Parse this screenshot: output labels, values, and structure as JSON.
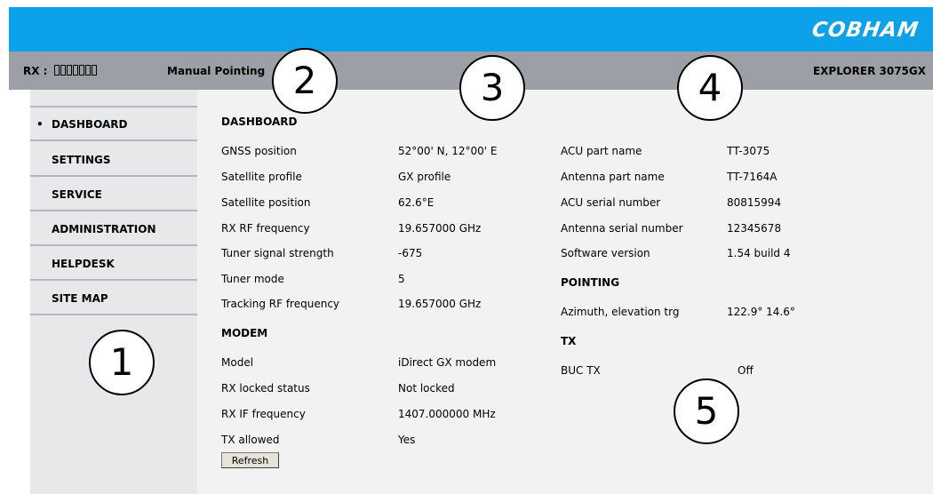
{
  "brand": {
    "logo_text": "COBHAM",
    "topbar_color": "#0ca1e8",
    "statusbar_color": "#9c9fa5"
  },
  "status": {
    "rx_label": "RX :",
    "mode": "Manual Pointing",
    "product": "EXPLORER 3075GX"
  },
  "nav": {
    "items": [
      {
        "label": "DASHBOARD",
        "active": true
      },
      {
        "label": "SETTINGS"
      },
      {
        "label": "SERVICE"
      },
      {
        "label": "ADMINISTRATION"
      },
      {
        "label": "HELPDESK"
      },
      {
        "label": "SITE MAP"
      }
    ],
    "active_bullet": "•"
  },
  "dashboard": {
    "title": "DASHBOARD",
    "left_rows": [
      {
        "label": "GNSS position",
        "value": "52°00' N, 12°00' E"
      },
      {
        "label": "Satellite profile",
        "value": "GX profile"
      },
      {
        "label": "Satellite position",
        "value": "62.6°E"
      },
      {
        "label": "RX RF frequency",
        "value": "19.657000 GHz"
      },
      {
        "label": "Tuner signal strength",
        "value": "-675"
      },
      {
        "label": "Tuner mode",
        "value": "5"
      },
      {
        "label": "Tracking RF frequency",
        "value": "19.657000 GHz"
      }
    ],
    "modem_title": "MODEM",
    "modem_rows": [
      {
        "label": "Model",
        "value": "iDirect GX modem"
      },
      {
        "label": "RX locked status",
        "value": "Not locked"
      },
      {
        "label": "RX IF frequency",
        "value": "1407.000000 MHz"
      },
      {
        "label": "TX allowed",
        "value": "Yes"
      }
    ],
    "refresh_label": "Refresh",
    "right_rows": [
      {
        "label": "ACU part name",
        "value": "TT-3075"
      },
      {
        "label": "Antenna part name",
        "value": "TT-7164A"
      },
      {
        "label": "ACU serial number",
        "value": "80815994"
      },
      {
        "label": "Antenna serial number",
        "value": "12345678"
      },
      {
        "label": "Software version",
        "value": "1.54 build 4"
      }
    ],
    "pointing_title": "POINTING",
    "pointing_rows": [
      {
        "label": "Azimuth, elevation trg",
        "value": "122.9° 14.6°"
      }
    ],
    "tx_title": "TX",
    "tx_rows": [
      {
        "label": "BUC TX",
        "value": "Off"
      }
    ]
  },
  "callouts": [
    "1",
    "2",
    "3",
    "4",
    "5"
  ]
}
